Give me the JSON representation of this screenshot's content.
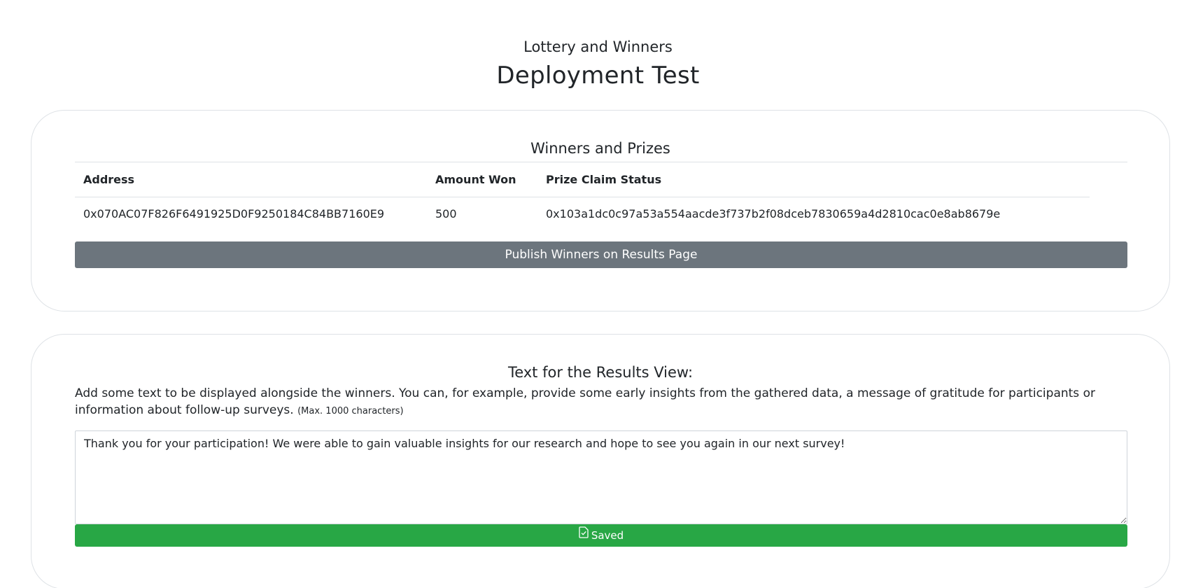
{
  "header": {
    "subtitle": "Lottery and Winners",
    "title": "Deployment Test"
  },
  "winners": {
    "section_title": "Winners and Prizes",
    "columns": [
      "Address",
      "Amount Won",
      "Prize Claim Status"
    ],
    "rows": [
      {
        "address": "0x070AC07F826F6491925D0F9250184C84BB7160E9",
        "amount": "500",
        "status": "0x103a1dc0c97a53a554aacde3f737b2f08dceb7830659a4d2810cac0e8ab8679e"
      }
    ],
    "publish_label": "Publish Winners on Results Page",
    "publish_color": "#6c757d"
  },
  "results": {
    "section_title": "Text for the Results View:",
    "description": "Add some text to be displayed alongside the winners. You can, for example, provide some early insights from the gathered data, a message of gratitude for participants or information about follow-up surveys.",
    "max_note": "(Max. 1000 characters)",
    "text_value": "Thank you for your participation! We were able to gain valuable insights for our research and hope to see you again in our next survey!",
    "saved_label": "Saved",
    "saved_icon": "file-check-icon",
    "saved_color": "#28a745"
  }
}
